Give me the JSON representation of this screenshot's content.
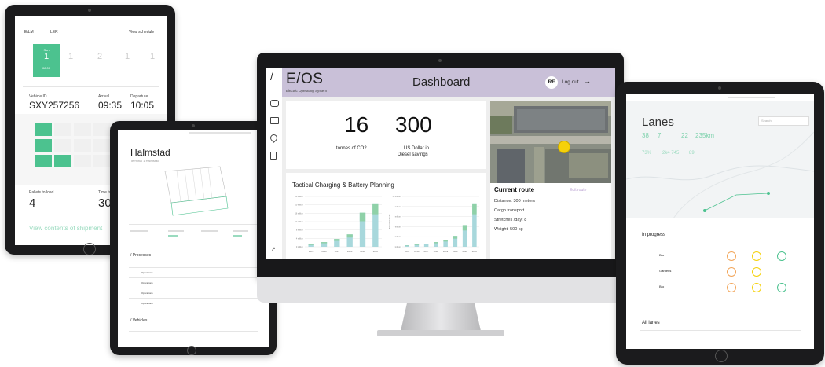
{
  "tablet_schedule": {
    "header_left": "E/LM",
    "header_mid": "LER",
    "view_schedule": "View schedule",
    "day_cards": [
      {
        "label": "Sun",
        "num": "1",
        "sub": "08:00"
      },
      {
        "label": "",
        "num": "1",
        "sub": ""
      },
      {
        "label": "",
        "num": "2",
        "sub": ""
      },
      {
        "label": "",
        "num": "1",
        "sub": ""
      },
      {
        "label": "",
        "num": "1",
        "sub": ""
      }
    ],
    "vehicle_id_label": "Vehicle ID",
    "vehicle_id": "SXY257256",
    "arrival_label": "Arrival",
    "arrival": "09:35",
    "departure_label": "Departure",
    "departure": "10:05",
    "pallets_label": "Pallets to load",
    "pallets": "4",
    "time_label": "Time to un",
    "time_value": "30",
    "view_contents": "View contents of shipment",
    "accent": "#4cc28f"
  },
  "tablet_halmstad": {
    "title": "Halmstad",
    "subtitle": "Terminal 1 Halmstad",
    "processes_title": "/ Processes",
    "vehicles_title": "/ Vehicles",
    "process_rows": [
      "Operations",
      "Operations",
      "Operations",
      "Operations"
    ]
  },
  "dashboard": {
    "logo": "E/OS",
    "logo_sub": "Electric Operating System",
    "title": "Dashboard",
    "user_initials": "RF",
    "logout": "Log out",
    "logout_arrow": "→",
    "sidebar_slash": "/",
    "co2_value": "16",
    "co2_label": "tonnes of CO2",
    "usd_value": "300",
    "usd_label_1": "US Dollar in",
    "usd_label_2": "Diesel savings",
    "charging_title": "Tactical Charging & Battery Planning",
    "current_route_title": "Current route",
    "edit_route": "Edit route",
    "route_distance": "Distance: 300 meters",
    "route_cargo": "Cargo transport",
    "route_stretches": "Stretches /day: 8",
    "route_weight": "Weight: 500 kg",
    "header_color": "#c9c0d8",
    "marker_color": "#f5d10a"
  },
  "chart_data": [
    {
      "type": "bar",
      "categories": [
        "2015",
        "2016",
        "2017",
        "2018",
        "2019",
        "2020"
      ],
      "series": [
        {
          "values": [
            0.3,
            0.6,
            1.0,
            1.6,
            4.4,
            5.6
          ]
        }
      ],
      "ylabel": "",
      "ytick_labels": [
        "26 million",
        "20 million",
        "16 million",
        "12 million",
        "8 million",
        "4 million",
        "0 million"
      ],
      "ylim": [
        0,
        6.5
      ]
    },
    {
      "type": "bar",
      "categories": [
        "2015",
        "2016",
        "2017",
        "2018",
        "2019",
        "2020",
        "2021",
        "2022"
      ],
      "series": [
        {
          "values": [
            0.2,
            0.3,
            0.4,
            0.6,
            0.9,
            1.4,
            2.8,
            5.6
          ]
        }
      ],
      "ylabel": "Amount of trucks",
      "ytick_labels": [
        "16 million",
        "8 million",
        "6 million",
        "4 million",
        "2 million",
        "0 million"
      ],
      "ylim": [
        0,
        6.5
      ]
    }
  ],
  "tablet_lanes": {
    "title": "Lanes",
    "stats": [
      {
        "value": "38",
        "label": "All lanes"
      },
      {
        "value": "7",
        "label": "Electrified lanes"
      },
      {
        "value": "22",
        "label": "In progress"
      },
      {
        "value": "235km",
        "label": "Distance electrified"
      }
    ],
    "stats2": [
      {
        "value": "73%",
        "label": "Planned"
      },
      {
        "value": "2k4 745",
        "label": "Weekly cost of BEV"
      },
      {
        "value": "89",
        "label": "Trucks"
      }
    ],
    "search_placeholder": "Search",
    "in_progress": "In progress",
    "all_lanes": "All lanes",
    "rows": [
      "Bro",
      "Gardens",
      "Bro"
    ],
    "accent": "#4cc28f"
  }
}
